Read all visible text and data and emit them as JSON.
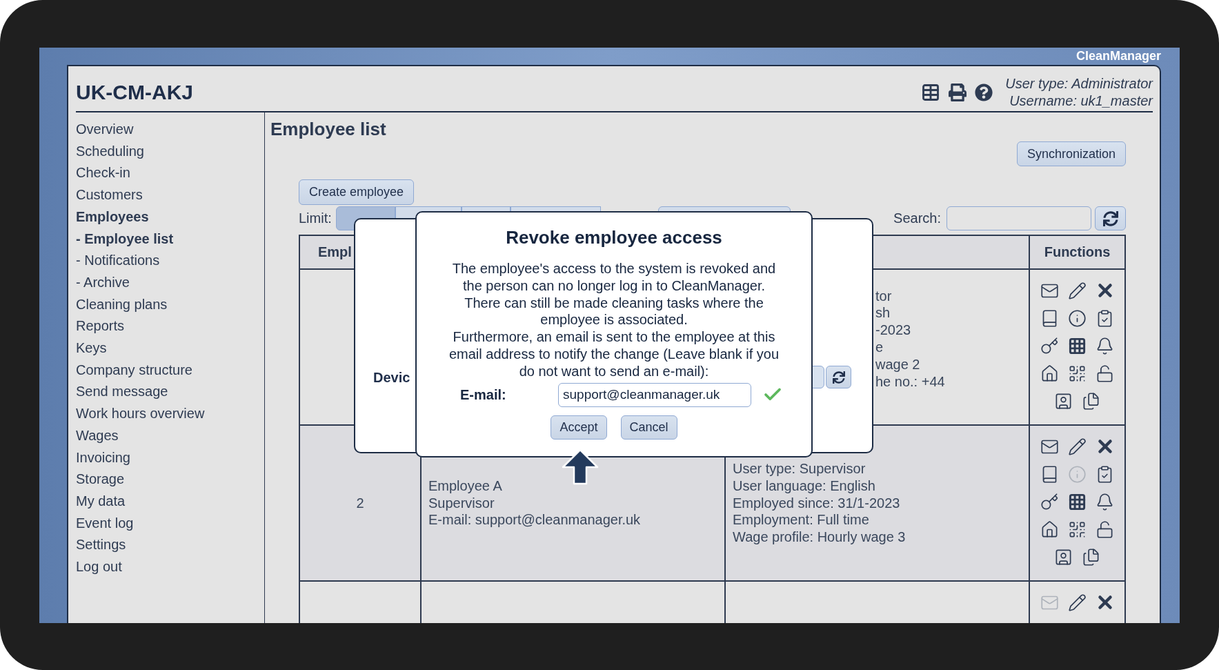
{
  "app_name": "CleanManager",
  "header": {
    "title": "UK-CM-AKJ",
    "user_type": "User type: Administrator",
    "username": "Username: uk1_master"
  },
  "sidebar": {
    "items": [
      {
        "label": "Overview",
        "selected": false
      },
      {
        "label": "Scheduling",
        "selected": false
      },
      {
        "label": "Check-in",
        "selected": false
      },
      {
        "label": "Customers",
        "selected": false
      },
      {
        "label": "Employees",
        "selected": true,
        "children": [
          {
            "label": "- Employee list",
            "selected": true
          },
          {
            "label": "- Notifications",
            "selected": false
          },
          {
            "label": "- Archive",
            "selected": false
          }
        ]
      },
      {
        "label": "Cleaning plans",
        "selected": false
      },
      {
        "label": "Reports",
        "selected": false
      },
      {
        "label": "Keys",
        "selected": false
      },
      {
        "label": "Company structure",
        "selected": false
      },
      {
        "label": "Send message",
        "selected": false
      },
      {
        "label": "Work hours overview",
        "selected": false
      },
      {
        "label": "Wages",
        "selected": false
      },
      {
        "label": "Invoicing",
        "selected": false
      },
      {
        "label": "Storage",
        "selected": false
      },
      {
        "label": "My data",
        "selected": false
      },
      {
        "label": "Event log",
        "selected": false
      },
      {
        "label": "Settings",
        "selected": false
      },
      {
        "label": "Log out",
        "selected": false
      }
    ]
  },
  "page": {
    "title": "Employee list",
    "sync_button": "Synchronization",
    "create_button": "Create employee",
    "limit_label": "Limit:",
    "limit_options": [
      {
        "selected": true
      },
      {
        "selected": false
      },
      {
        "selected": false
      },
      {
        "selected": false
      }
    ],
    "search_label": "Search:"
  },
  "table": {
    "column_1": "Empl",
    "functions_heading": "Functions",
    "rows": [
      {
        "details_fragments": [
          "tor",
          "sh",
          "-2023",
          "e",
          "wage 2",
          "he no.: +44"
        ],
        "functions": [
          {
            "kind": "mail",
            "disabled": false
          },
          {
            "kind": "edit",
            "disabled": false
          },
          {
            "kind": "delete",
            "disabled": false
          },
          {
            "kind": "book",
            "disabled": false
          },
          {
            "kind": "info",
            "disabled": false
          },
          {
            "kind": "checklist",
            "disabled": false
          },
          {
            "kind": "key",
            "disabled": false
          },
          {
            "kind": "calendar",
            "disabled": false
          },
          {
            "kind": "bell",
            "disabled": false
          },
          {
            "kind": "home",
            "disabled": false
          },
          {
            "kind": "qr",
            "disabled": false
          },
          {
            "kind": "unlock",
            "disabled": false
          },
          {
            "kind": "contact",
            "disabled": false
          },
          {
            "kind": "documents",
            "disabled": false
          }
        ]
      },
      {
        "number": "2",
        "employee": [
          "Employee A",
          "Supervisor",
          "E-mail: support@cleanmanager.uk"
        ],
        "details": [
          "User type: Supervisor",
          "User language: English",
          "Employed since: 31/1-2023",
          "Employment: Full time",
          "Wage profile: Hourly wage 3"
        ],
        "functions": [
          {
            "kind": "mail",
            "disabled": false
          },
          {
            "kind": "edit",
            "disabled": false
          },
          {
            "kind": "delete",
            "disabled": false
          },
          {
            "kind": "book",
            "disabled": false
          },
          {
            "kind": "info",
            "disabled": true
          },
          {
            "kind": "checklist",
            "disabled": false
          },
          {
            "kind": "key",
            "disabled": false
          },
          {
            "kind": "calendar",
            "disabled": false
          },
          {
            "kind": "bell",
            "disabled": false
          },
          {
            "kind": "home",
            "disabled": false
          },
          {
            "kind": "qr",
            "disabled": false
          },
          {
            "kind": "unlock",
            "disabled": false
          },
          {
            "kind": "contact",
            "disabled": false
          },
          {
            "kind": "documents",
            "disabled": false
          }
        ]
      },
      {
        "functions": [
          {
            "kind": "mail",
            "disabled": true
          },
          {
            "kind": "edit",
            "disabled": false
          },
          {
            "kind": "delete",
            "disabled": false
          }
        ]
      }
    ]
  },
  "dialog_behind": {
    "label": "Devic"
  },
  "dialog": {
    "title": "Revoke employee access",
    "paragraphs": [
      "The employee's access to the system is revoked and the person can no longer log in to CleanManager. There can still be made cleaning tasks where the employee is associated.",
      "Furthermore, an email is sent to the employee at this email address to notify the change (Leave blank if you do not want to send an e-mail):"
    ],
    "email_label": "E-mail:",
    "email_value": "support@cleanmanager.uk",
    "email_valid": true,
    "buttons": [
      "Accept",
      "Cancel"
    ]
  }
}
